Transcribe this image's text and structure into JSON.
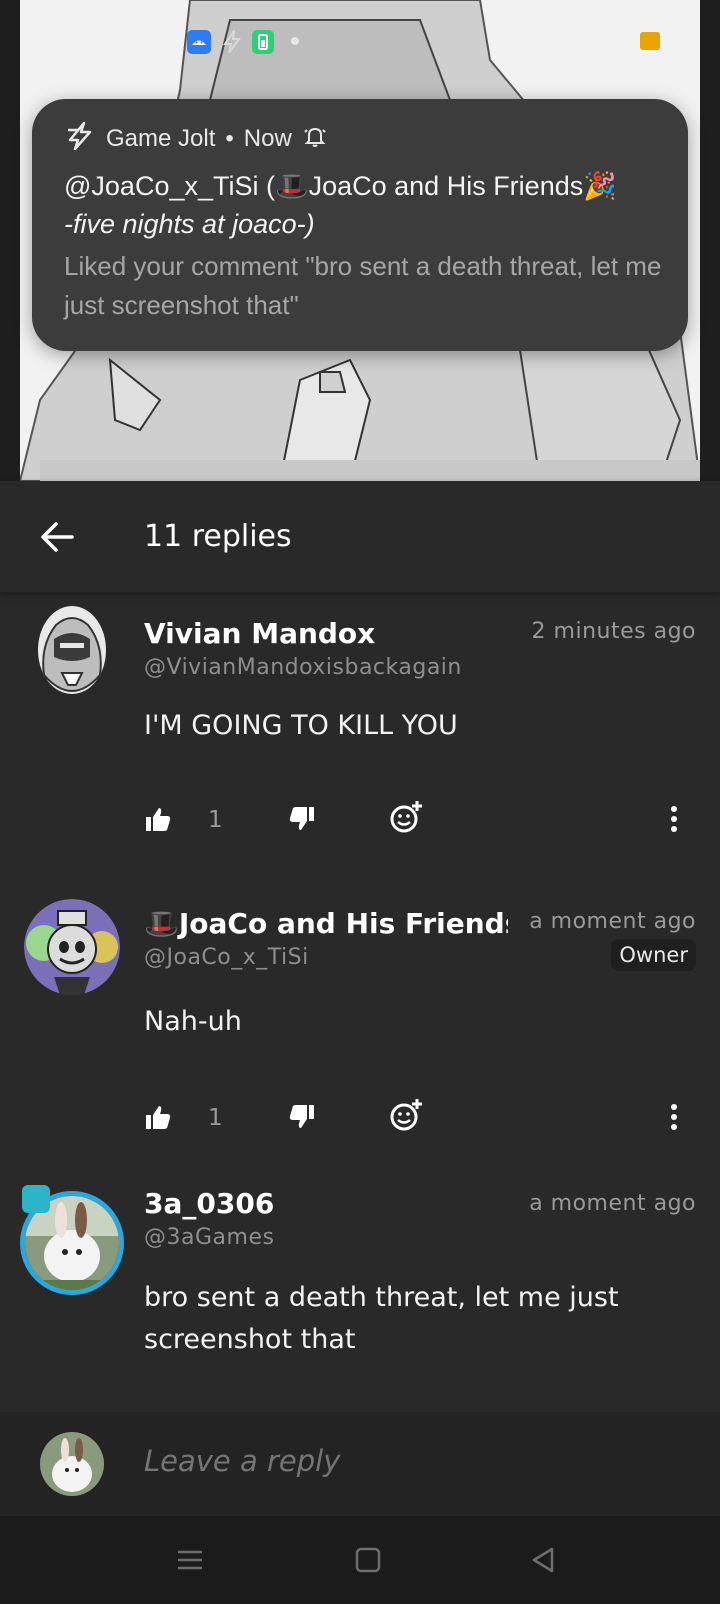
{
  "status_bar": {
    "icons": [
      "android-icon",
      "game-jolt-bolt-icon",
      "battery-saver-icon",
      "dot-icon",
      "orange-square-icon"
    ]
  },
  "notification": {
    "app": "Game Jolt",
    "separator": "•",
    "time": "Now",
    "title_line1": "@JoaCo_x_TiSi (🎩JoaCo and His Friends🎉",
    "title_line2": "-five nights at joaco-)",
    "body": "Liked your comment \"bro sent a death threat, let me just screenshot that\""
  },
  "header": {
    "title": "11 replies"
  },
  "comments": [
    {
      "name": "Vivian Mandox",
      "handle": "@VivianMandoxisbackagain",
      "time": "2 minutes ago",
      "text": "I'M GOING TO KILL YOU",
      "likes": "1"
    },
    {
      "name": "🎩JoaCo and His Friends",
      "handle": "@JoaCo_x_TiSi",
      "time": "a moment ago",
      "badge": "Owner",
      "text": "Nah-uh",
      "likes": "1"
    },
    {
      "name": "3a_0306",
      "handle": "@3aGames",
      "time": "a moment ago",
      "text": "bro sent a death threat, let me just screenshot that"
    }
  ],
  "reply_bar": {
    "placeholder": "Leave a reply"
  },
  "colors": {
    "background": "#292929",
    "notification_bg": "#3c3c3c",
    "avatar_ring": "#29a8e0",
    "reply_bar_bg": "#232323"
  }
}
